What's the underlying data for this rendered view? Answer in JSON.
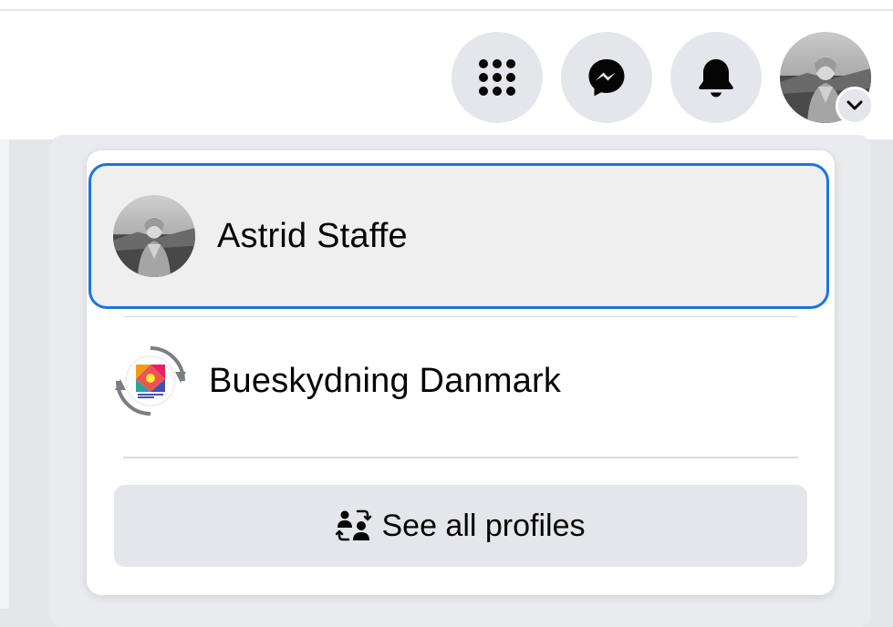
{
  "header": {
    "menu_button": {
      "icon": "grid-menu-icon"
    },
    "messenger_button": {
      "icon": "messenger-icon"
    },
    "notifications_button": {
      "icon": "bell-icon"
    },
    "account_button": {
      "icon": "chevron-down-icon"
    }
  },
  "dropdown": {
    "profiles": [
      {
        "name": "Astrid Staffe",
        "selected": true
      },
      {
        "name": "Bueskydning Danmark",
        "selected": false,
        "icon": "switch-profile-icon"
      }
    ],
    "see_all_label": "See all profiles",
    "see_all_icon": "switch-profiles-icon"
  },
  "colors": {
    "accent": "#1b74e4",
    "button_bg": "#e4e6eb",
    "text": "#050505"
  }
}
